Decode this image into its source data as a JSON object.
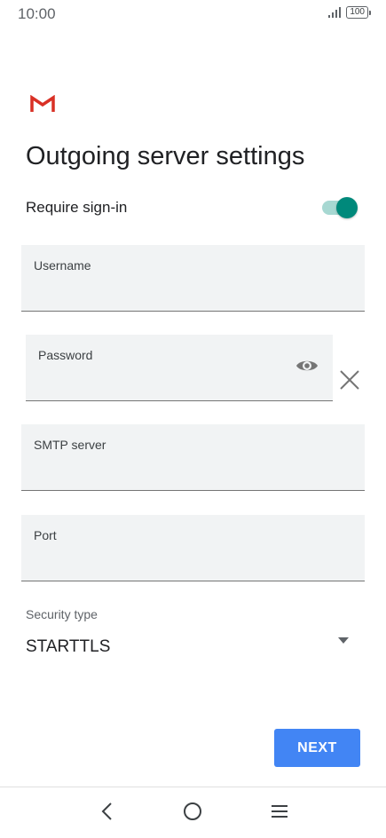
{
  "status_bar": {
    "time": "10:00",
    "battery": "100"
  },
  "app": {
    "logo_icon": "gmail-icon",
    "title": "Outgoing server settings"
  },
  "require_signin": {
    "label": "Require sign-in",
    "enabled": true
  },
  "fields": {
    "username": {
      "label": "Username",
      "value": ""
    },
    "password": {
      "label": "Password",
      "value": "",
      "show_icon": "eye-icon",
      "clear_icon": "close-icon"
    },
    "smtp_server": {
      "label": "SMTP server",
      "value": ""
    },
    "port": {
      "label": "Port",
      "value": ""
    }
  },
  "security": {
    "label": "Security type",
    "value": "STARTTLS",
    "icon": "dropdown-arrow-icon"
  },
  "actions": {
    "next_label": "NEXT"
  },
  "nav": {
    "back_icon": "back-icon",
    "home_icon": "home-icon",
    "menu_icon": "menu-icon"
  },
  "colors": {
    "accent": "#4285f4",
    "toggle_on": "#00897b",
    "field_bg": "#f1f3f4",
    "gmail_red": "#d93025"
  }
}
